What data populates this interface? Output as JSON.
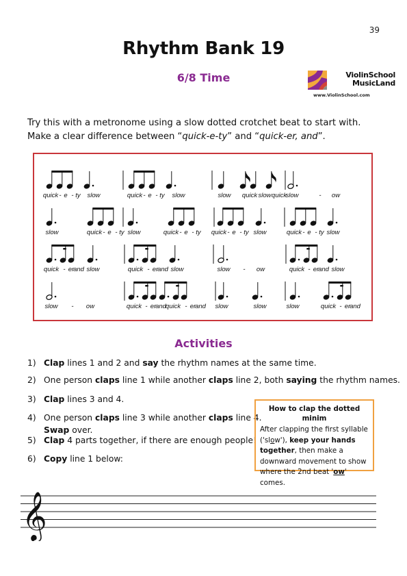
{
  "page": {
    "number": "39"
  },
  "header": {
    "title": "Rhythm Bank 19",
    "subtitle": "6/8 Time"
  },
  "logo": {
    "line1": "ViolinSchool",
    "line2": "MusicLand",
    "url": "www.ViolinSchool.com",
    "colors": {
      "orange": "#f2a93b",
      "purple": "#8a2a91",
      "red": "#d2433a",
      "grey": "#8c8c8c"
    }
  },
  "intro": {
    "line1": "Try this with a metronome using a slow dotted crotchet beat to start with.",
    "line2_prefix": "Make a clear difference between “",
    "term1": "quick-e-ty",
    "line2_mid": "” and “",
    "term2": "quick-er, and",
    "line2_suffix": "”."
  },
  "rhythm_lines": [
    {
      "bars": [
        {
          "notes": [
            "3-quavers",
            "dotted-crotchet"
          ],
          "labels": [
            "quick",
            "-",
            "e",
            "-",
            "ty",
            "slow"
          ]
        },
        {
          "notes": [
            "3-quavers",
            "dotted-crotchet"
          ],
          "labels": [
            "quick",
            "-",
            "e",
            "-",
            "ty",
            "slow"
          ]
        },
        {
          "notes": [
            "crotchet",
            "quaver",
            "crotchet",
            "quaver"
          ],
          "labels": [
            "slow",
            "quick",
            "slow",
            "quick"
          ]
        },
        {
          "notes": [
            "dotted-minim"
          ],
          "labels": [
            "slow",
            "-",
            "ow"
          ]
        }
      ]
    },
    {
      "bars": [
        {
          "notes": [
            "dotted-crotchet",
            "3-quavers"
          ],
          "labels": [
            "slow",
            "quick",
            "-",
            "e",
            "-",
            "ty"
          ]
        },
        {
          "notes": [
            "dotted-crotchet",
            "3-quavers"
          ],
          "labels": [
            "slow",
            "quick",
            "-",
            "e",
            "-",
            "ty"
          ]
        },
        {
          "notes": [
            "3-quavers",
            "dotted-crotchet"
          ],
          "labels": [
            "quick",
            "-",
            "e",
            "-",
            "ty",
            "slow"
          ]
        },
        {
          "notes": [
            "3-quavers",
            "dotted-crotchet"
          ],
          "labels": [
            "quick",
            "-",
            "e",
            "-",
            "ty",
            "slow"
          ]
        }
      ]
    },
    {
      "bars": [
        {
          "notes": [
            "dotted-quaver-semiquaver-quaver",
            "dotted-crotchet"
          ],
          "labels": [
            "quick",
            "-",
            "er",
            "and",
            "slow"
          ]
        },
        {
          "notes": [
            "dotted-quaver-semiquaver-quaver",
            "dotted-crotchet"
          ],
          "labels": [
            "quick",
            "-",
            "er",
            "and",
            "slow"
          ]
        },
        {
          "notes": [
            "dotted-minim"
          ],
          "labels": [
            "slow",
            "-",
            "ow"
          ]
        },
        {
          "notes": [
            "dotted-quaver-semiquaver-quaver",
            "dotted-crotchet"
          ],
          "labels": [
            "quick",
            "-",
            "er",
            "and",
            "slow"
          ]
        }
      ]
    },
    {
      "bars": [
        {
          "notes": [
            "dotted-minim"
          ],
          "labels": [
            "slow",
            "-",
            "ow"
          ]
        },
        {
          "notes": [
            "dotted-quaver-semiquaver-quaver",
            "dotted-quaver-semiquaver-quaver"
          ],
          "labels": [
            "quick",
            "-",
            "er",
            "and",
            "quick",
            "-",
            "er",
            "and"
          ]
        },
        {
          "notes": [
            "dotted-crotchet",
            "dotted-crotchet"
          ],
          "labels": [
            "slow",
            "slow"
          ]
        },
        {
          "notes": [
            "dotted-crotchet",
            "dotted-quaver-semiquaver-quaver"
          ],
          "labels": [
            "slow",
            "quick",
            "-",
            "er",
            "and"
          ]
        }
      ]
    }
  ],
  "activities": {
    "title": "Activities",
    "items": [
      {
        "num": "1)",
        "parts": [
          [
            "b",
            "Clap"
          ],
          [
            "t",
            " lines 1 and 2 and "
          ],
          [
            "b",
            "say"
          ],
          [
            "t",
            " the rhythm names at the same time."
          ]
        ]
      },
      {
        "num": "2)",
        "parts": [
          [
            "t",
            "One person "
          ],
          [
            "b",
            "claps"
          ],
          [
            "t",
            " line 1 while another "
          ],
          [
            "b",
            "claps"
          ],
          [
            "t",
            " line 2, both "
          ],
          [
            "b",
            "saying"
          ],
          [
            "t",
            " the rhythm names."
          ]
        ]
      },
      {
        "num": "3)",
        "parts": [
          [
            "b",
            "Clap"
          ],
          [
            "t",
            " lines 3 and 4."
          ]
        ]
      },
      {
        "num": "4)",
        "parts": [
          [
            "t",
            "One person "
          ],
          [
            "b",
            "claps"
          ],
          [
            "t",
            " line 3 while another "
          ],
          [
            "b",
            "claps"
          ],
          [
            "t",
            " line 4."
          ]
        ],
        "line2": [
          [
            "b",
            "Swap"
          ],
          [
            "t",
            " over."
          ]
        ]
      },
      {
        "num": "5)",
        "parts": [
          [
            "b",
            "Clap"
          ],
          [
            "t",
            " 4 parts together, if there are enough people!"
          ]
        ]
      },
      {
        "num": "6)",
        "parts": [
          [
            "b",
            "Copy"
          ],
          [
            "t",
            " line 1 below:"
          ]
        ]
      }
    ]
  },
  "tip": {
    "title": "How to clap the dotted minim",
    "body_1": "After clapping the first syllable ('sl",
    "body_u": "o",
    "body_2": "w'), ",
    "bold_1": "keep your hands together",
    "body_3": ", then make a downward movement to show where the 2nd beat '",
    "bold_2": "ow",
    "body_4": "' comes."
  },
  "staff": {
    "clef": "treble-clef",
    "lines": 5
  }
}
